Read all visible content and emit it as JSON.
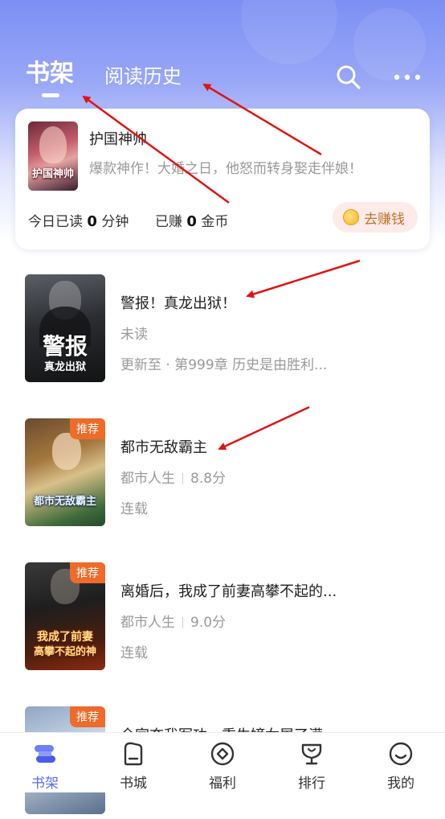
{
  "header": {
    "tabs": [
      {
        "label": "书架",
        "active": true
      },
      {
        "label": "阅读历史",
        "active": false
      }
    ],
    "icons": [
      "search-icon",
      "more-icon"
    ]
  },
  "featured": {
    "title": "护国神帅",
    "description": "爆款神作！大婚之日，他怒而转身娶走伴娘！",
    "cover_text": "护国神帅",
    "read_prefix": "今日已读",
    "read_value": "0",
    "read_unit": "分钟",
    "earned_prefix": "已赚",
    "earned_value": "0",
    "earned_unit": "金币",
    "earn_button": "去赚钱"
  },
  "books": [
    {
      "title": "警报！真龙出狱！",
      "line2": "未读",
      "line3": "更新至 · 第999章  历史是由胜利...",
      "cover_big": "警报",
      "cover_small": "真龙出狱"
    },
    {
      "title": "都市无敌霸主",
      "tag": "推荐",
      "genre": "都市人生",
      "score": "8.8分",
      "status": "连载",
      "cover_big": "都市无敌霸主"
    },
    {
      "title": "离婚后，我成了前妻高攀不起的...",
      "tag": "推荐",
      "genre": "都市人生",
      "score": "9.0分",
      "status": "连载",
      "cover_big": "我成了前妻",
      "cover_small": "高攀不起的神"
    },
    {
      "title": "全家夺我军功，重生嫡女屠了满...",
      "tag": "推荐"
    }
  ],
  "bottom_nav": [
    {
      "label": "书架",
      "icon": "bookshelf-icon",
      "active": true
    },
    {
      "label": "书城",
      "icon": "bookstore-icon",
      "active": false
    },
    {
      "label": "福利",
      "icon": "welfare-icon",
      "active": false
    },
    {
      "label": "排行",
      "icon": "ranking-icon",
      "active": false
    },
    {
      "label": "我的",
      "icon": "profile-icon",
      "active": false
    }
  ],
  "colors": {
    "accent": "#5a6ef0",
    "header_gradient_top": "#7c8ff4",
    "tag_orange": "#ee6b2a",
    "earn_text": "#c0742a",
    "annotation_arrow": "#e01414"
  }
}
